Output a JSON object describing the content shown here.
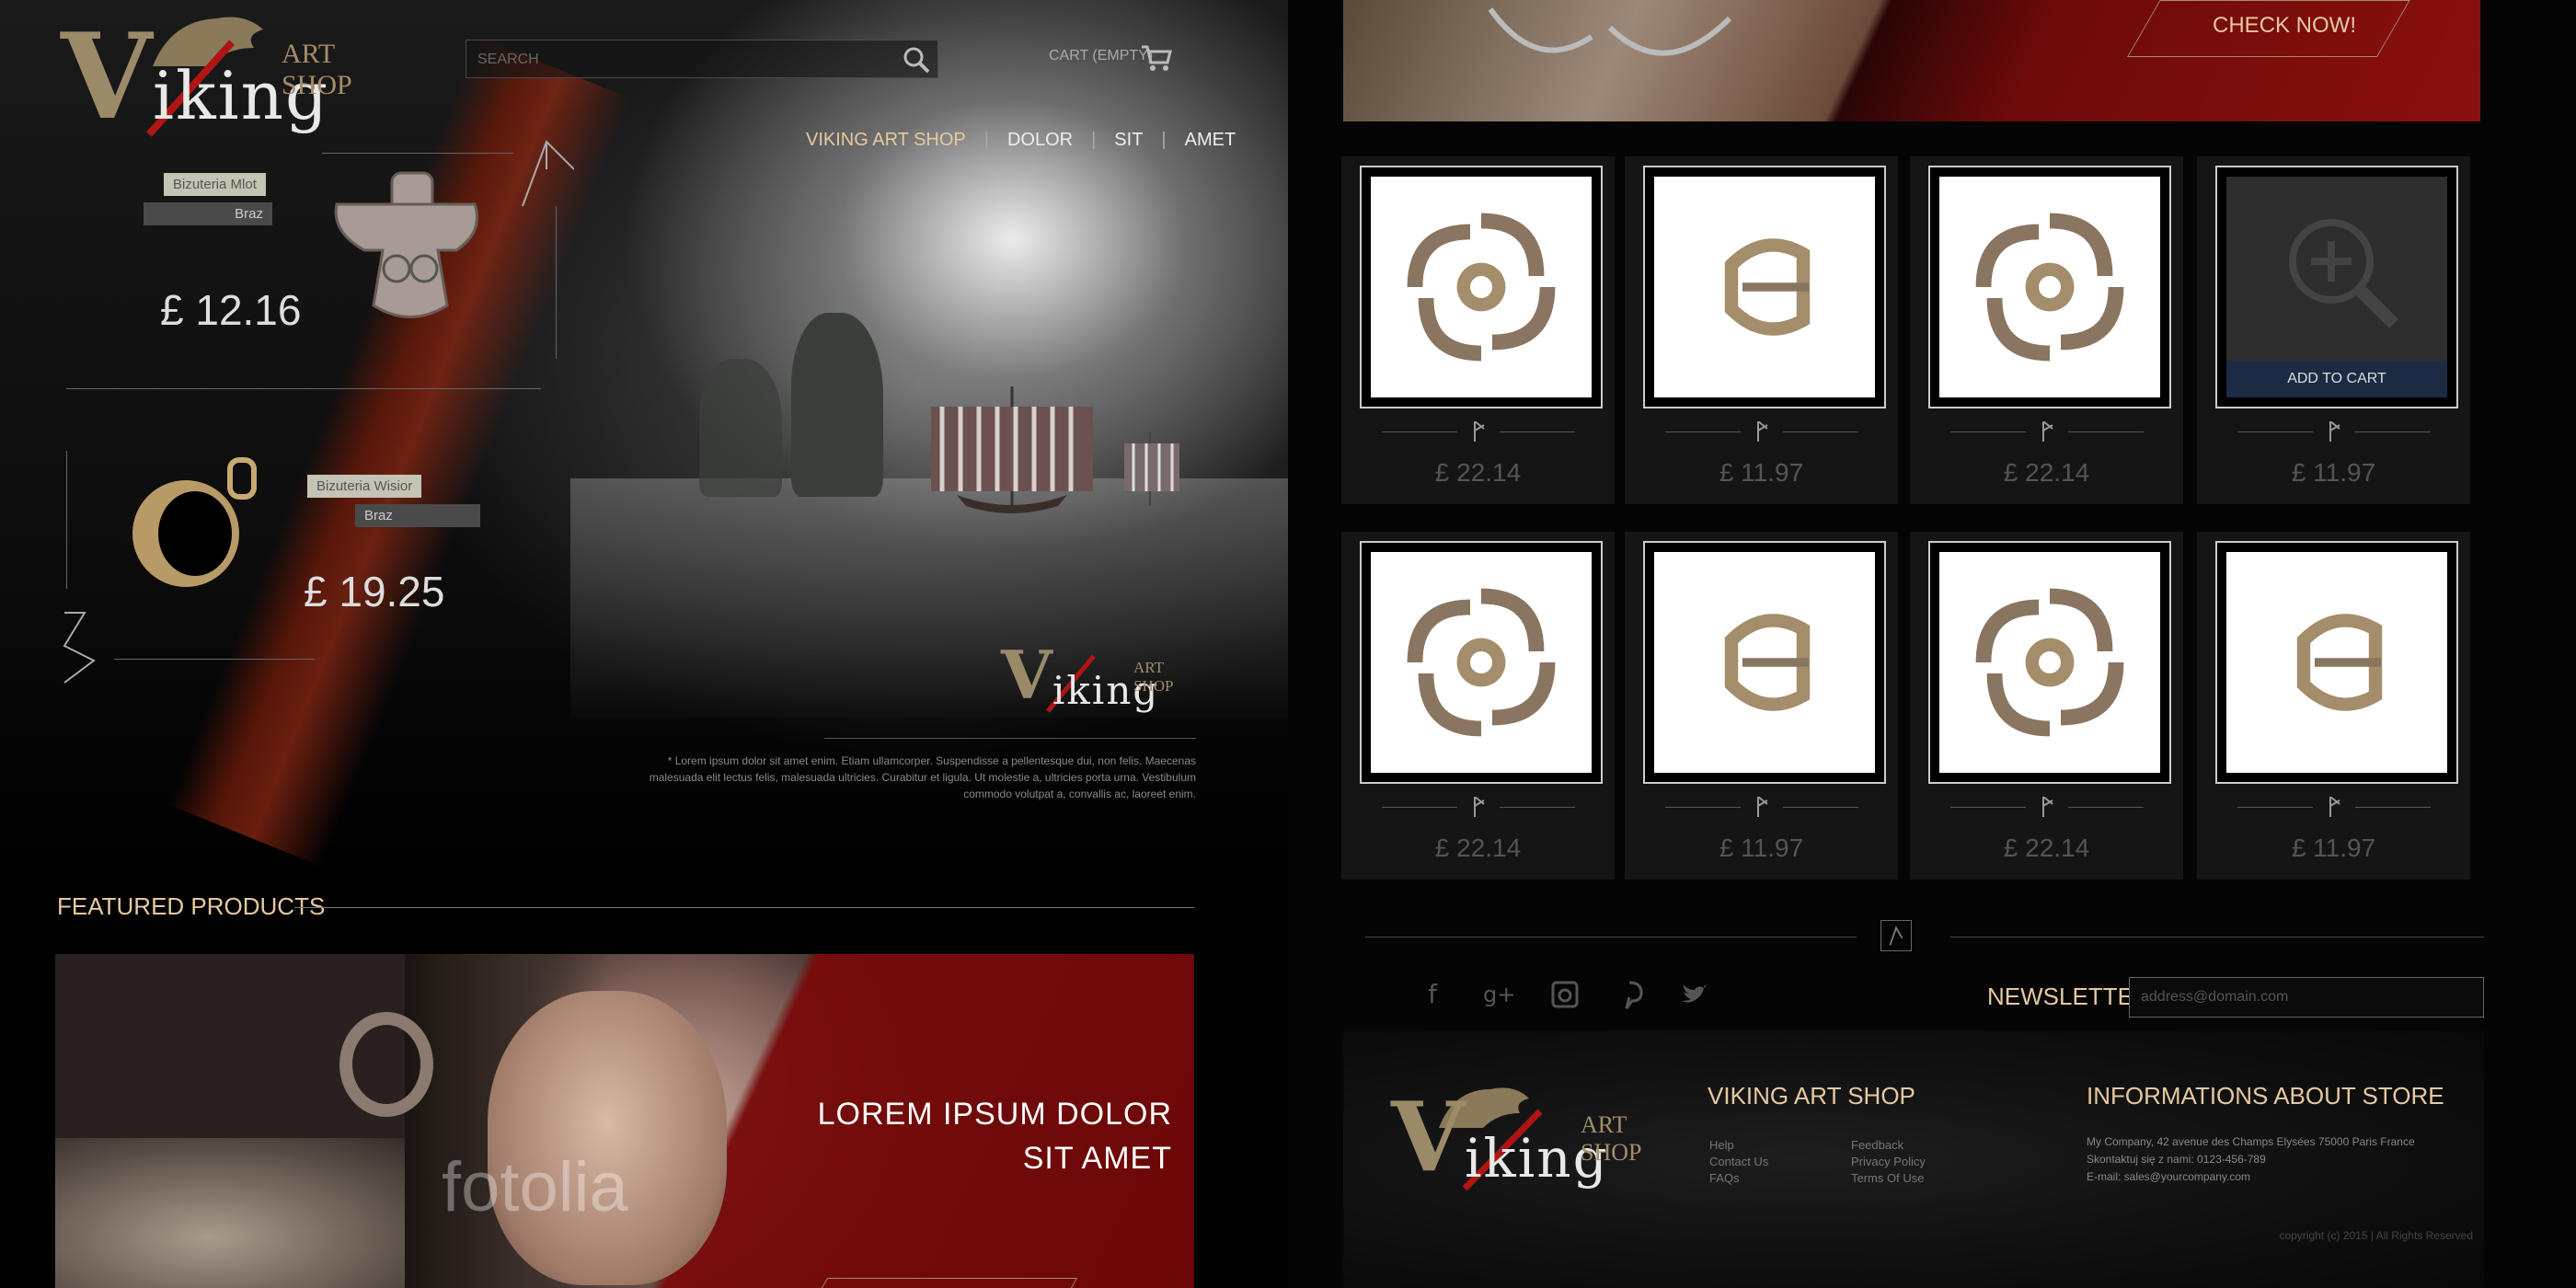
{
  "brand": {
    "v": "V",
    "king": "iking",
    "artshop": "ART SHOP"
  },
  "search": {
    "placeholder": "SEARCH"
  },
  "cart": {
    "label": "CART (EMPTY)"
  },
  "nav": {
    "items": [
      "VIKING ART SHOP",
      "DOLOR",
      "SIT",
      "AMET"
    ],
    "active_color": "#e6c9a0"
  },
  "hero_products": [
    {
      "tag": "Bizuteria Mlot",
      "sub": "Braz",
      "price": "£ 12.16"
    },
    {
      "tag": "Bizuteria Wisior",
      "sub": "Braz",
      "price": "£ 19.25"
    }
  ],
  "hero_lorem": "* Lorem ipsum dolor sit amet enim. Etiam ullamcorper. Suspendisse a pellentesque dui, non felis. Maecenas malesuada elit lectus felis, malesuada ultricies. Curabitur et ligula. Ut molestie a, ultricies porta urna. Vestibulum commodo volutpat a, convallis ac, laoreet enim.",
  "featured": {
    "title": "FEATURED PRODUCTS",
    "banner_line1": "LOREM IPSUM DOLOR",
    "banner_line2": "SIT AMET",
    "watermark": "fotolia"
  },
  "right_banner": {
    "cta": "CHECK NOW!"
  },
  "products": [
    {
      "price": "£ 22.14",
      "kind": "brooch"
    },
    {
      "price": "£ 11.97",
      "kind": "buckle"
    },
    {
      "price": "£ 22.14",
      "kind": "brooch"
    },
    {
      "price": "£ 11.97",
      "kind": "hover",
      "add_to_cart": "ADD TO CART"
    },
    {
      "price": "£ 22.14",
      "kind": "brooch"
    },
    {
      "price": "£ 11.97",
      "kind": "buckle"
    },
    {
      "price": "£ 22.14",
      "kind": "brooch"
    },
    {
      "price": "£ 11.97",
      "kind": "buckle"
    }
  ],
  "social": [
    "facebook-icon",
    "google-plus-icon",
    "instagram-icon",
    "pinterest-icon",
    "twitter-icon"
  ],
  "newsletter": {
    "label": "NEWSLETTER",
    "placeholder": "address@domain.com"
  },
  "footer": {
    "col1_title": "VIKING ART SHOP",
    "links_a": [
      "Help",
      "Contact Us",
      "FAQs"
    ],
    "links_b": [
      "Feedback",
      "Privacy Policy",
      "Terms Of Use"
    ],
    "col2_title": "INFORMATIONS ABOUT STORE",
    "info": [
      "My Company, 42 avenue des Champs Elysées 75000 Paris France",
      "Skontaktuj się z nami: 0123-456-789",
      "E-mail: sales@yourcompany.com"
    ],
    "copyright": "copyright (c) 2015 | All Rights Reserved"
  },
  "colors": {
    "accent": "#e6c9a0",
    "blood": "#8a1010",
    "panel": "#151515"
  }
}
